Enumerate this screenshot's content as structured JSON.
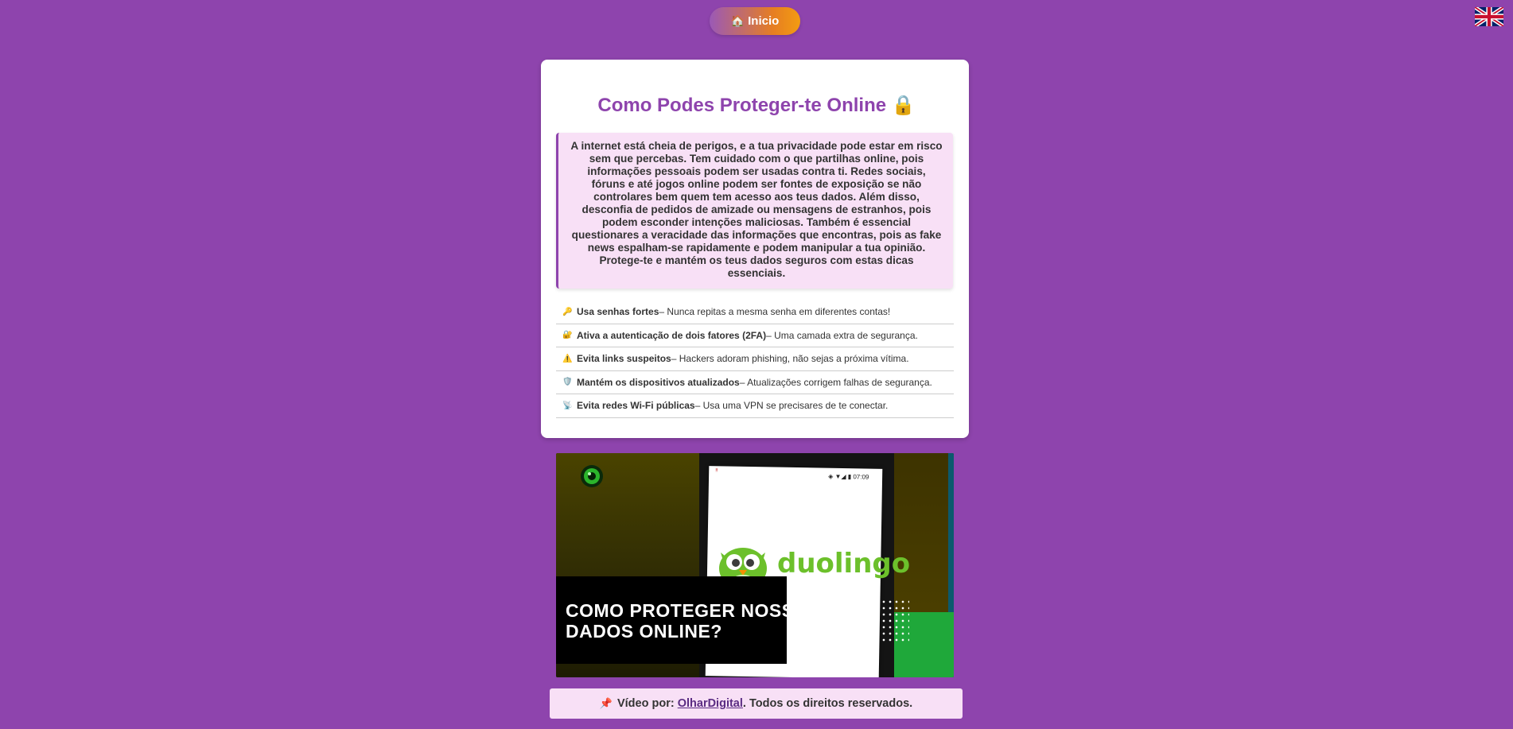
{
  "nav": {
    "home_icon": "house-icon",
    "home_label": "Inicio",
    "language_flag": "uk-flag-icon"
  },
  "main": {
    "title": "Como Podes Proteger-te Online",
    "title_icon": "lock-icon",
    "intro": "A internet está cheia de perigos, e a tua privacidade pode estar em risco sem que percebas. Tem cuidado com o que partilhas online, pois informações pessoais podem ser usadas contra ti. Redes sociais, fóruns e até jogos online podem ser fontes de exposição se não controlares bem quem tem acesso aos teus dados. Além disso, desconfia de pedidos de amizade ou mensagens de estranhos, pois podem esconder intenções maliciosas. Também é essencial questionares a veracidade das informações que encontras, pois as fake news espalham-se rapidamente e podem manipular a tua opinião. Protege-te e mantém os teus dados seguros com estas dicas essenciais.",
    "tips": [
      {
        "icon": "key-icon",
        "title": "Usa senhas fortes",
        "text": " – Nunca repitas a mesma senha em diferentes contas!"
      },
      {
        "icon": "lock-icon",
        "title": "Ativa a autenticação de dois fatores (2FA)",
        "text": " – Uma camada extra de segurança."
      },
      {
        "icon": "warning-icon",
        "title": "Evita links suspeitos",
        "text": " – Hackers adoram phishing, não sejas a próxima vítima."
      },
      {
        "icon": "shield-icon",
        "title": "Mantém os dispositivos atualizados",
        "text": " – Atualizações corrigem falhas de segurança."
      },
      {
        "icon": "satellite-icon",
        "title": "Evita redes Wi-Fi públicas",
        "text": " – Usa uma VPN se precisares de te conectar."
      }
    ]
  },
  "video": {
    "caption": "COMO PROTEGER NOSSOS\nDADOS ONLINE?",
    "brand_text": "duolingo",
    "status_time": "07:09",
    "status_mark": "!!",
    "colors": {
      "duo_green": "#6cc02b",
      "accent_green": "#1fa83a"
    }
  },
  "credit": {
    "pin_icon": "pushpin-icon",
    "prefix": "Vídeo por: ",
    "link": "OlharDigital",
    "suffix": ". Todos os direitos reservados."
  },
  "colors": {
    "background": "#8e44ad",
    "title": "#8e44ad",
    "intro_bg": "#f8e0f6"
  }
}
